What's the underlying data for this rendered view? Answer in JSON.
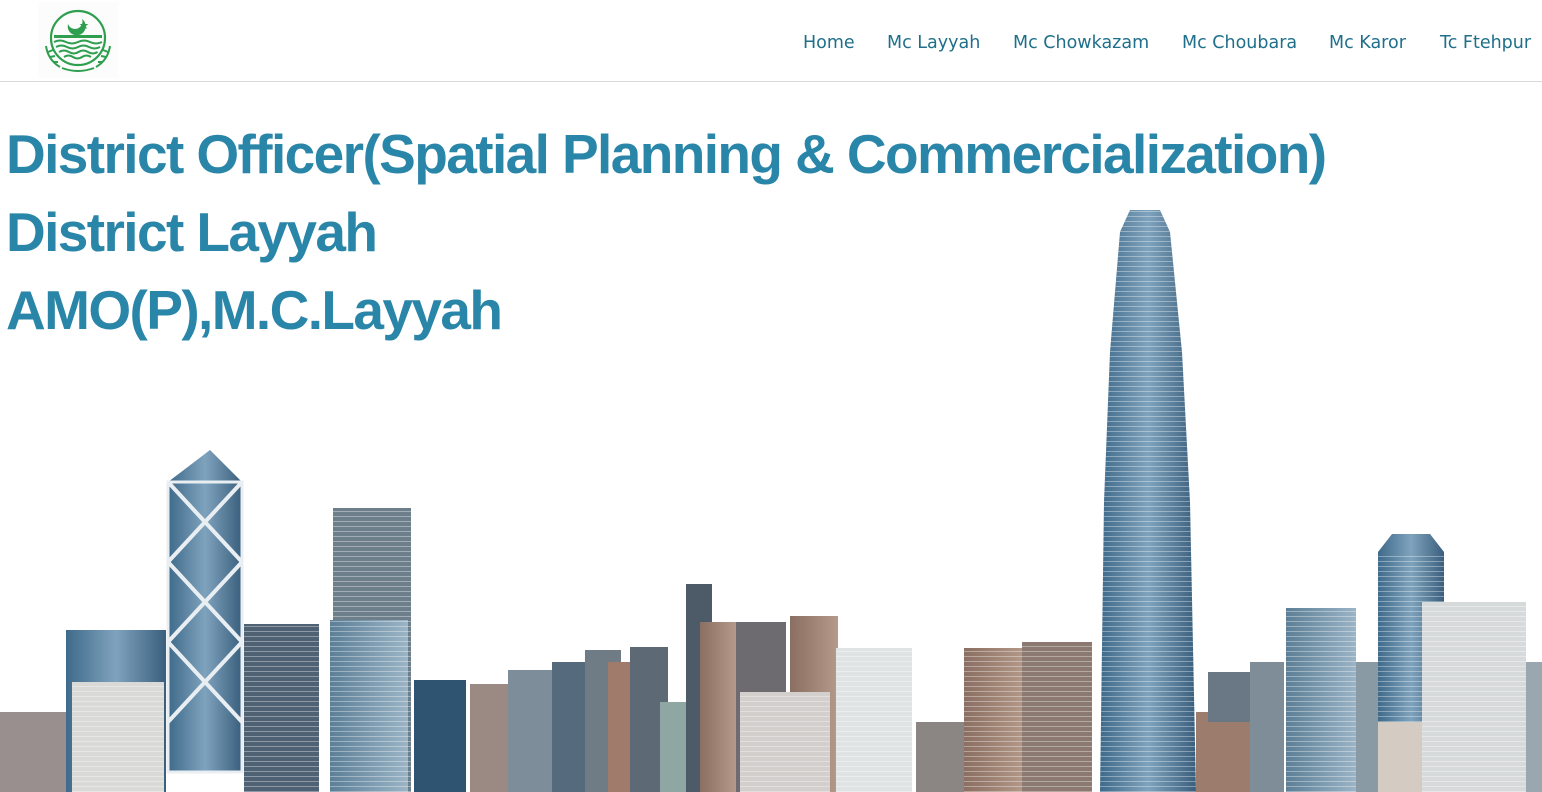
{
  "header": {
    "logo_icon": "punjab-government-emblem",
    "nav": [
      {
        "label": "Home"
      },
      {
        "label": "Mc Layyah"
      },
      {
        "label": "Mc Chowkazam"
      },
      {
        "label": "Mc Choubara"
      },
      {
        "label": "Mc Karor"
      },
      {
        "label": "Tc Ftehpur"
      }
    ]
  },
  "hero": {
    "lines": [
      "District Officer(Spatial Planning & Commercialization)",
      "District Layyah",
      "AMO(P),M.C.Layyah"
    ],
    "image": "city-skyline"
  },
  "colors": {
    "nav_text": "#1f6f8b",
    "hero_text": "#2a86a8",
    "logo_green": "#2e9e4f"
  }
}
